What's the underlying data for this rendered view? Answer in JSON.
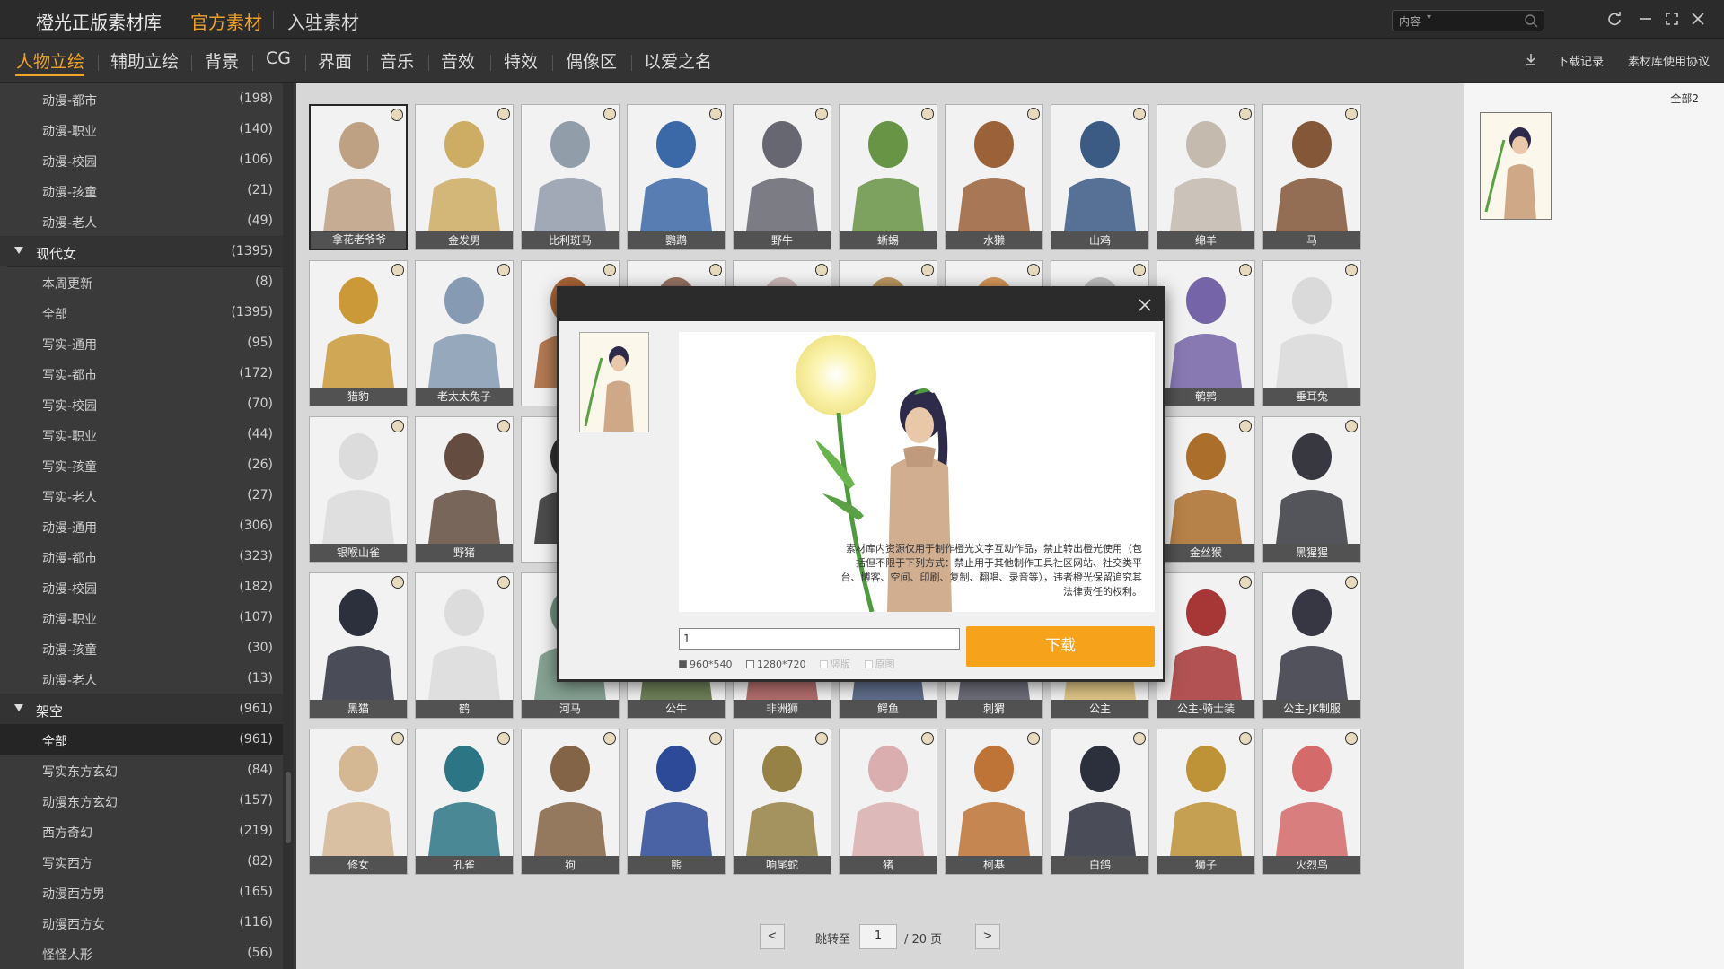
{
  "app": {
    "brand": "橙光正版素材库",
    "top_tabs": [
      {
        "label": "官方素材",
        "active": true
      },
      {
        "label": "入驻素材",
        "active": false
      }
    ],
    "search_scope": "内容",
    "search_placeholder": ""
  },
  "categories": [
    {
      "label": "人物立绘",
      "active": true
    },
    {
      "label": "辅助立绘",
      "active": false
    },
    {
      "label": "背景",
      "active": false
    },
    {
      "label": "CG",
      "active": false
    },
    {
      "label": "界面",
      "active": false
    },
    {
      "label": "音乐",
      "active": false
    },
    {
      "label": "音效",
      "active": false
    },
    {
      "label": "特效",
      "active": false
    },
    {
      "label": "偶像区",
      "active": false
    },
    {
      "label": "以爱之名",
      "active": false
    }
  ],
  "toolbar": {
    "download_history": "下载记录",
    "license": "素材库使用协议"
  },
  "sidebar": [
    {
      "type": "item",
      "label": "动漫-都市",
      "count": "(198)"
    },
    {
      "type": "item",
      "label": "动漫-职业",
      "count": "(140)"
    },
    {
      "type": "item",
      "label": "动漫-校园",
      "count": "(106)"
    },
    {
      "type": "item",
      "label": "动漫-孩童",
      "count": "(21)"
    },
    {
      "type": "item",
      "label": "动漫-老人",
      "count": "(49)"
    },
    {
      "type": "section",
      "label": "现代女",
      "count": "(1395)"
    },
    {
      "type": "item",
      "label": "本周更新",
      "count": "(8)"
    },
    {
      "type": "item",
      "label": "全部",
      "count": "(1395)"
    },
    {
      "type": "item",
      "label": "写实-通用",
      "count": "(95)"
    },
    {
      "type": "item",
      "label": "写实-都市",
      "count": "(172)"
    },
    {
      "type": "item",
      "label": "写实-校园",
      "count": "(70)"
    },
    {
      "type": "item",
      "label": "写实-职业",
      "count": "(44)"
    },
    {
      "type": "item",
      "label": "写实-孩童",
      "count": "(26)"
    },
    {
      "type": "item",
      "label": "写实-老人",
      "count": "(27)"
    },
    {
      "type": "item",
      "label": "动漫-通用",
      "count": "(306)"
    },
    {
      "type": "item",
      "label": "动漫-都市",
      "count": "(323)"
    },
    {
      "type": "item",
      "label": "动漫-校园",
      "count": "(182)"
    },
    {
      "type": "item",
      "label": "动漫-职业",
      "count": "(107)"
    },
    {
      "type": "item",
      "label": "动漫-孩童",
      "count": "(30)"
    },
    {
      "type": "item",
      "label": "动漫-老人",
      "count": "(13)"
    },
    {
      "type": "section",
      "label": "架空",
      "count": "(961)"
    },
    {
      "type": "item",
      "label": "全部",
      "count": "(961)",
      "selected": true
    },
    {
      "type": "item",
      "label": "写实东方玄幻",
      "count": "(84)"
    },
    {
      "type": "item",
      "label": "动漫东方玄幻",
      "count": "(157)"
    },
    {
      "type": "item",
      "label": "西方奇幻",
      "count": "(219)"
    },
    {
      "type": "item",
      "label": "写实西方",
      "count": "(82)"
    },
    {
      "type": "item",
      "label": "动漫西方男",
      "count": "(165)"
    },
    {
      "type": "item",
      "label": "动漫西方女",
      "count": "(116)"
    },
    {
      "type": "item",
      "label": "怪怪人形",
      "count": "(56)"
    }
  ],
  "grid": {
    "rows": [
      [
        {
          "name": "拿花老爷爷",
          "color": "#c9a98a",
          "selected": true
        },
        {
          "name": "金发男",
          "color": "#d8b66a"
        },
        {
          "name": "比利斑马",
          "color": "#9aa6b4"
        },
        {
          "name": "鹦鹉",
          "color": "#3f6fb0"
        },
        {
          "name": "野牛",
          "color": "#6d6d78"
        },
        {
          "name": "蜥蜴",
          "color": "#6e9c4a"
        },
        {
          "name": "水獭",
          "color": "#a4683e"
        },
        {
          "name": "山鸡",
          "color": "#3f5f8c"
        },
        {
          "name": "绵羊",
          "color": "#cfc6b8"
        },
        {
          "name": "马",
          "color": "#8b5c3c"
        }
      ],
      [
        {
          "name": "猎豹",
          "color": "#d6a23c"
        },
        {
          "name": "老太太兔子",
          "color": "#8ea4bd"
        },
        {
          "name": "",
          "color": "#b06a3a"
        },
        {
          "name": "",
          "color": "#a07a6a"
        },
        {
          "name": "",
          "color": "#d9c4c4"
        },
        {
          "name": "",
          "color": "#c8a06a"
        },
        {
          "name": "",
          "color": "#e0a060"
        },
        {
          "name": "",
          "color": "#cccccc"
        },
        {
          "name": "鹌鹑",
          "color": "#7c6ab0"
        },
        {
          "name": "垂耳兔",
          "color": "#e6e6e6"
        }
      ],
      [
        {
          "name": "银喉山雀",
          "color": "#e8e8e8"
        },
        {
          "name": "野猪",
          "color": "#6a5244"
        },
        {
          "name": "",
          "color": "#333333"
        },
        {
          "name": "",
          "color": "#ffffff"
        },
        {
          "name": "",
          "color": "#ffffff"
        },
        {
          "name": "",
          "color": "#ffffff"
        },
        {
          "name": "",
          "color": "#ffffff"
        },
        {
          "name": "",
          "color": "#ffffff"
        },
        {
          "name": "金丝猴",
          "color": "#b5742e"
        },
        {
          "name": "黑猩猩",
          "color": "#3c3c44"
        }
      ],
      [
        {
          "name": "黑猫",
          "color": "#2f3340"
        },
        {
          "name": "鹤",
          "color": "#e8e8e8"
        },
        {
          "name": "河马",
          "color": "#7a9c8a"
        },
        {
          "name": "公牛",
          "color": "#5a7040"
        },
        {
          "name": "非洲狮",
          "color": "#b05a5a"
        },
        {
          "name": "鳄鱼",
          "color": "#4a5a80"
        },
        {
          "name": "刺猬",
          "color": "#5a5a6a"
        },
        {
          "name": "公主",
          "color": "#e6c87a"
        },
        {
          "name": "公主-骑士装",
          "color": "#b03a3a"
        },
        {
          "name": "公主-JK制服",
          "color": "#3a3a48"
        }
      ],
      [
        {
          "name": "修女",
          "color": "#e0c29c"
        },
        {
          "name": "孔雀",
          "color": "#2f7c8c"
        },
        {
          "name": "狗",
          "color": "#8c6a4a"
        },
        {
          "name": "熊",
          "color": "#2f4fa0"
        },
        {
          "name": "响尾蛇",
          "color": "#a08a4a"
        },
        {
          "name": "猪",
          "color": "#e6b8b8"
        },
        {
          "name": "柯基",
          "color": "#c97a3a"
        },
        {
          "name": "白鸽",
          "color": "#2f3340"
        },
        {
          "name": "狮子",
          "color": "#c99a3a"
        },
        {
          "name": "火烈鸟",
          "color": "#e07070"
        }
      ]
    ]
  },
  "pager": {
    "prev": "<",
    "next": ">",
    "jump_label": "跳转至",
    "current": "1",
    "total": "/ 20 页"
  },
  "right_panel": {
    "label": "全部2"
  },
  "modal": {
    "notice": "素材库内资源仅用于制作橙光文字互动作品，禁止转出橙光使用（包括但不限于下列方式：禁止用于其他制作工具社区网站、社交类平台、博客、空间、印刷、复制、翻唱、录音等），违者橙光保留追究其法律责任的权利。",
    "input_value": "1",
    "options": [
      {
        "label": "960*540",
        "checked": true,
        "disabled": false
      },
      {
        "label": "1280*720",
        "checked": false,
        "disabled": false
      },
      {
        "label": "竖版",
        "checked": false,
        "disabled": true
      },
      {
        "label": "原图",
        "checked": false,
        "disabled": true
      }
    ],
    "download_label": "下载"
  },
  "colors": {
    "accent": "#f0a32a",
    "download_button": "#f7a21b"
  }
}
